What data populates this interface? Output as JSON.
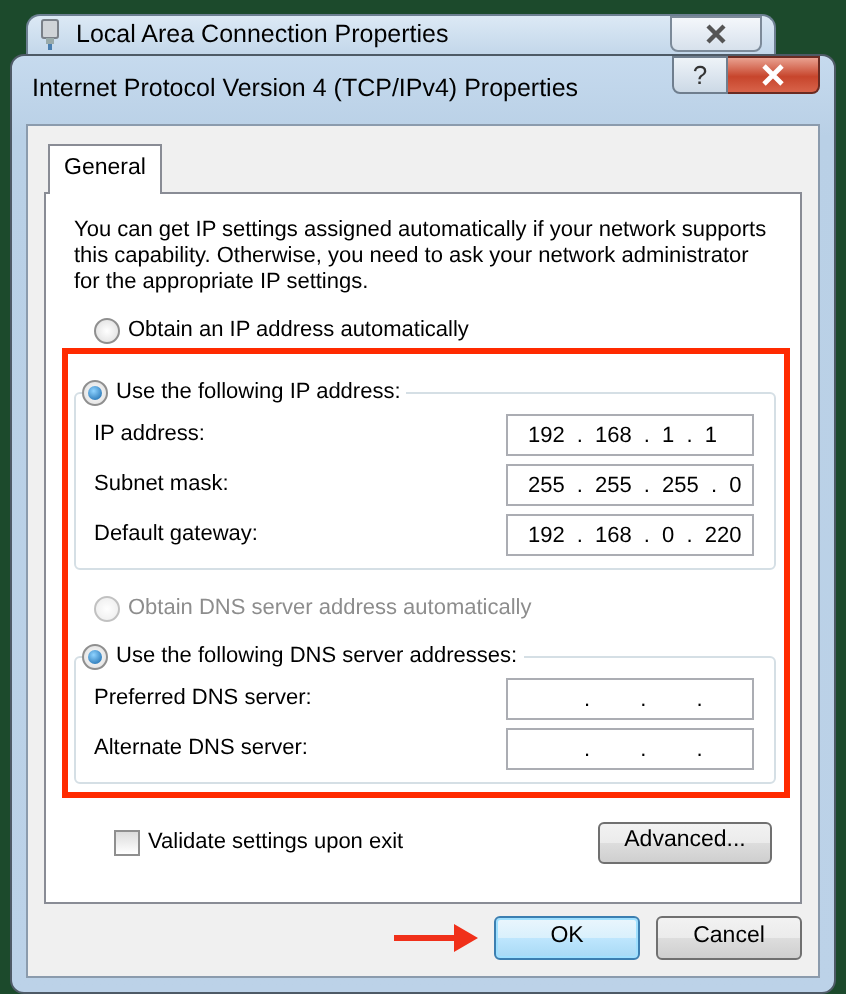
{
  "background_window": {
    "title": "Local Area Connection Properties"
  },
  "dialog": {
    "title": "Internet Protocol Version 4 (TCP/IPv4) Properties",
    "help_button": "?"
  },
  "tabs": [
    {
      "label": "General",
      "selected": true
    }
  ],
  "description": "You can get IP settings assigned automatically if your network supports this capability. Otherwise, you need to ask your network administrator for the appropriate IP settings.",
  "ip_options": [
    {
      "label": "Obtain an IP address automatically",
      "selected": false,
      "disabled": false
    },
    {
      "label": "Use the following IP address:",
      "selected": true,
      "disabled": false
    }
  ],
  "ip_fields": [
    {
      "label": "IP address:",
      "value": "192 . 168 . 1 . 1"
    },
    {
      "label": "Subnet mask:",
      "value": "255 . 255 . 255 . 0"
    },
    {
      "label": "Default gateway:",
      "value": "192 . 168 . 0 . 220"
    }
  ],
  "dns_options": [
    {
      "label": "Obtain DNS server address automatically",
      "selected": false,
      "disabled": true
    },
    {
      "label": "Use the following DNS server addresses:",
      "selected": true,
      "disabled": false
    }
  ],
  "dns_fields": [
    {
      "label": "Preferred DNS server:",
      "value": ". . ."
    },
    {
      "label": "Alternate DNS server:",
      "value": ". . ."
    }
  ],
  "validate": {
    "label": "Validate settings upon exit",
    "checked": false
  },
  "advanced_button": "Advanced...",
  "footer_buttons": [
    {
      "label": "OK",
      "focused": true
    },
    {
      "label": "Cancel",
      "focused": false
    }
  ]
}
